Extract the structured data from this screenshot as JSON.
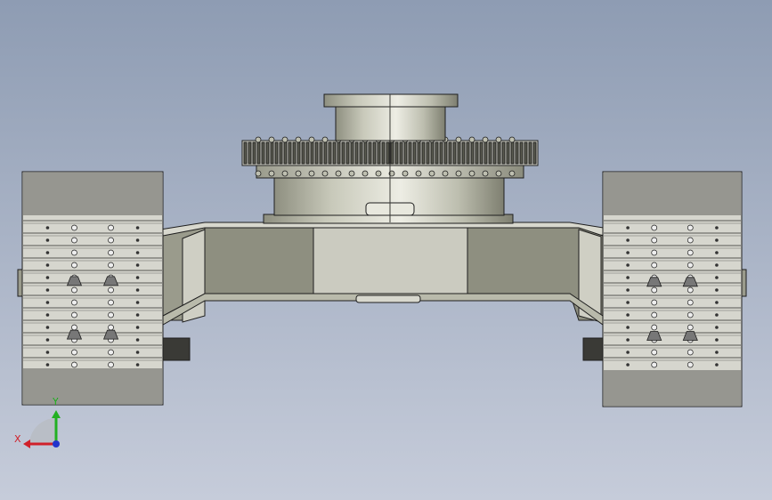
{
  "viewport": {
    "background_top": "#8E9CB3",
    "background_bottom": "#C6CCDA"
  },
  "model": {
    "metal_light": "#E4E4DA",
    "metal_mid": "#BFC0B1",
    "metal_dark": "#8A8C7C",
    "edge": "#1E1E1E",
    "track_body": "#D6D6CE",
    "track_line": "#2A2A2A"
  },
  "triad": {
    "x_label": "X",
    "y_label": "Y",
    "x_color": "#D0202A",
    "y_color": "#22B022",
    "z_color": "#2233CC"
  }
}
